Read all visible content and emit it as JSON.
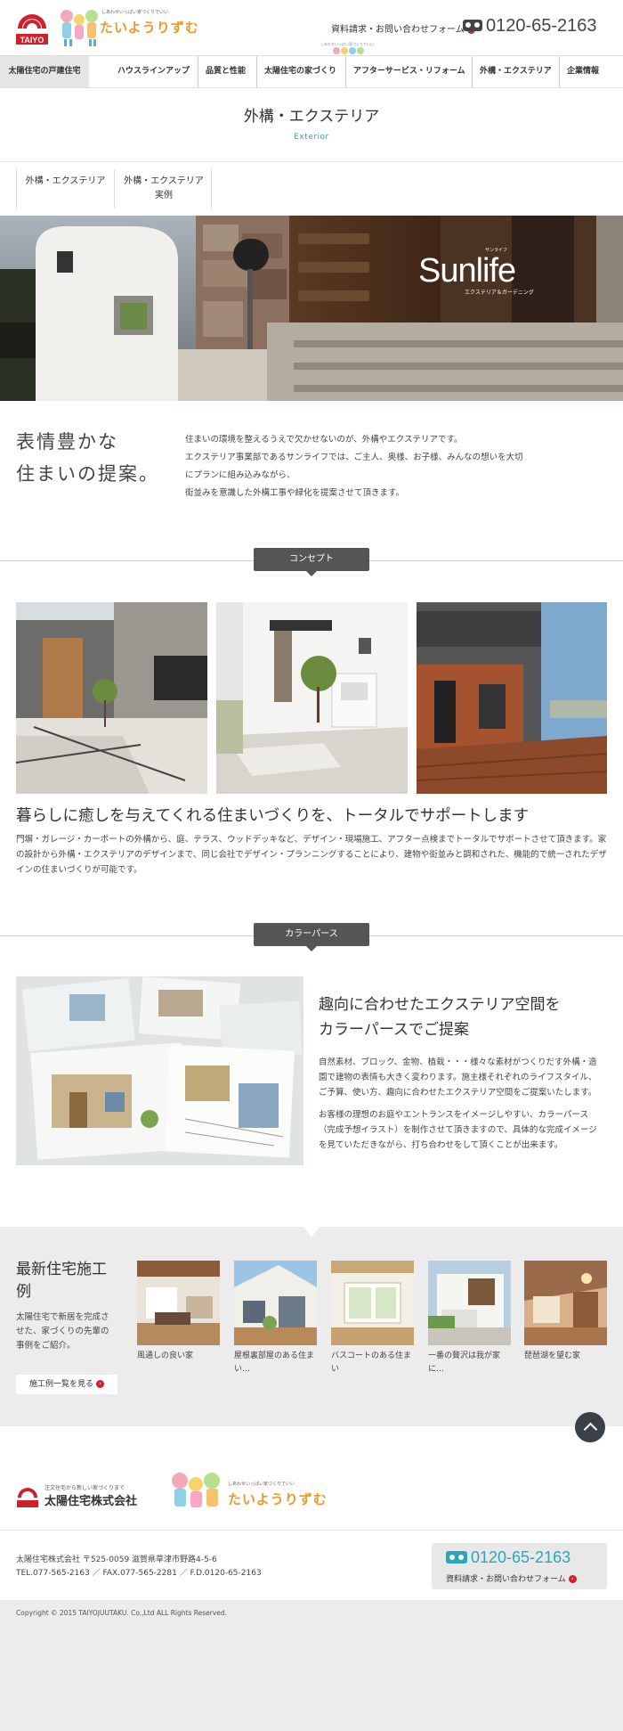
{
  "colors": {
    "accent": "#2aa6b8",
    "red": "#d0202b",
    "dark": "#555555"
  },
  "header": {
    "logo_text": "TAIYO",
    "kids_logo_small": "しあわせいっぱい家づくりでいい",
    "kids_logo": "たいようりずむ",
    "request_link": "資料請求・お問い合わせフォーム",
    "tel": "0120-65-2163"
  },
  "nav": {
    "active": "太陽住宅の戸建住宅",
    "items": [
      "ハウスラインアップ",
      "品質と性能",
      "太陽住宅の家づくり",
      "アフターサービス・リフォーム",
      "外構・エクステリア",
      "企業情報"
    ]
  },
  "page": {
    "title": "外構・エクステリア",
    "subtitle": "Exterior"
  },
  "subnav": [
    {
      "label": "外構・エクステリア"
    },
    {
      "label": "外構・エクステリア\n実例"
    }
  ],
  "hero": {
    "brand": "Sunlife",
    "brand_ruby": "サンライフ",
    "brand_sub": "エクステリア＆ガーデニング"
  },
  "intro": {
    "title_line1": "表情豊かな",
    "title_line2": "住まいの提案。",
    "text_line1": "住まいの環境を整えるうえで欠かせないのが、外構やエクステリアです。",
    "text_line2": "エクステリア事業部であるサンライフでは、ご主人、奥様、お子様、みんなの想いを大切",
    "text_line3": "にプランに組み込みながら、",
    "text_line4": "街並みを意識した外構工事や緑化を提案させて頂きます。"
  },
  "concept": {
    "tag": "コンセプト",
    "title": "暮らしに癒しを与えてくれる住まいづくりを、トータルでサポートします",
    "text": "門塀・ガレージ・カーポートの外構から、庭、テラス、ウッドデッキなど、デザイン・現場施工、アフター点検までトータルでサポートさせて頂きます。家の設計から外構・エクステリアのデザインまで、同じ会社でデザイン・プランニングすることにより、建物や街並みと調和された、機能的で統一されたデザインの住まいづくりが可能です。"
  },
  "color_perse": {
    "tag": "カラーパース",
    "title_line1": "趣向に合わせたエクステリア空間を",
    "title_line2": "カラーパースでご提案",
    "text1": "自然素材、ブロック、金物、植栽・・・様々な素材がつくりだす外構・造園で建物の表情も大きく変わります。施主様それぞれのライフスタイル、ご予算、使い方、趣向に合わせたエクステリア空間をご提案いたします。",
    "text2": "お客様の理想のお庭やエントランスをイメージしやすい、カラーパース（完成予想イラスト）を制作させて頂きますので、具体的な完成イメージを見ていただきながら、打ち合わせをして頂くことが出来ます。"
  },
  "cases": {
    "title": "最新住宅施工例",
    "desc": "太陽住宅で新居を完成させた、家づくりの先輩の事例をご紹介。",
    "button": "施工例一覧を見る",
    "items": [
      {
        "caption": "風通しの良い家"
      },
      {
        "caption": "屋根裏部屋のある住まい…"
      },
      {
        "caption": "バスコートのある住まい"
      },
      {
        "caption": "一番の贅沢は我が家に…"
      },
      {
        "caption": "琵琶湖を望む家"
      }
    ]
  },
  "footer": {
    "logo_tagline": "注文住宅から新しい家づくりまで",
    "company": "太陽住宅株式会社",
    "mascot_small": "しあわせいっぱい家づくりでいい",
    "mascot_logo": "たいようりずむ",
    "address": "太陽住宅株式会社 〒525-0059 滋賀県草津市野路4-5-6",
    "phones": "TEL.077-565-2163 ／ FAX.077-565-2281 ／ F.D.0120-65-2163",
    "tel": "0120-65-2163",
    "request": "資料請求・お問い合わせフォーム",
    "copyright": "Copyright © 2015 TAIYOJUUTAKU. Co.,Ltd ALL Rights Reserved."
  }
}
